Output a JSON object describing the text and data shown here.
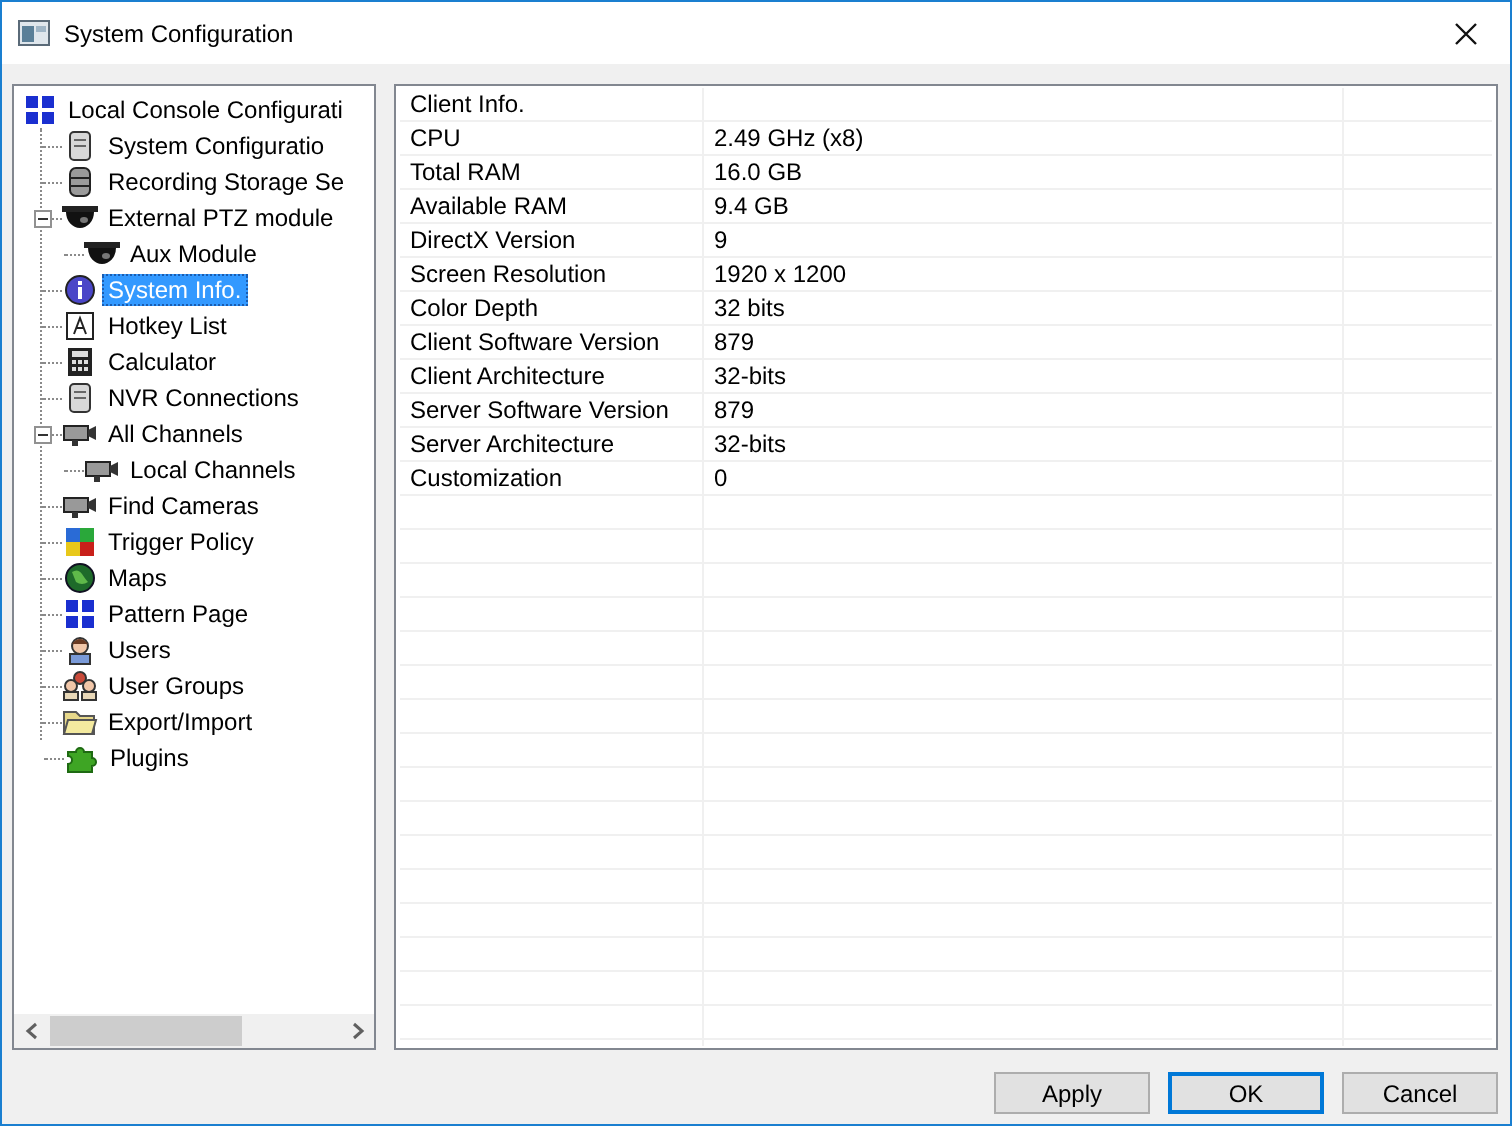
{
  "window": {
    "title": "System Configuration"
  },
  "tree": {
    "items": [
      {
        "label": "Local Console Configurati",
        "selected": false,
        "children": [
          {
            "label": "System Configuratio",
            "selected": false
          },
          {
            "label": "Recording Storage Se",
            "selected": false
          },
          {
            "label": "External PTZ module",
            "selected": false,
            "expanded": true,
            "children": [
              {
                "label": "Aux Module",
                "selected": false
              }
            ]
          },
          {
            "label": "System Info.",
            "selected": true
          },
          {
            "label": "Hotkey List",
            "selected": false
          },
          {
            "label": "Calculator",
            "selected": false
          },
          {
            "label": "NVR Connections",
            "selected": false
          },
          {
            "label": "All Channels",
            "selected": false,
            "expanded": true,
            "children": [
              {
                "label": "Local Channels",
                "selected": false
              }
            ]
          },
          {
            "label": "Find Cameras",
            "selected": false
          },
          {
            "label": "Trigger Policy",
            "selected": false
          },
          {
            "label": "Maps",
            "selected": false
          },
          {
            "label": "Pattern Page",
            "selected": false
          },
          {
            "label": "Users",
            "selected": false
          },
          {
            "label": "User Groups",
            "selected": false
          },
          {
            "label": "Export/Import",
            "selected": false
          },
          {
            "label": "Plugins",
            "selected": false
          }
        ]
      }
    ]
  },
  "table": {
    "rows": [
      {
        "cells": [
          "Client Info."
        ]
      },
      {
        "cells": [
          "CPU",
          "2.49 GHz (x8)"
        ]
      },
      {
        "cells": [
          "Total RAM",
          "16.0 GB"
        ]
      },
      {
        "cells": [
          "Available RAM",
          "9.4 GB"
        ]
      },
      {
        "cells": [
          "DirectX Version",
          "9"
        ]
      },
      {
        "cells": [
          "Screen Resolution",
          "1920 x 1200"
        ]
      },
      {
        "cells": [
          "Color Depth",
          "32 bits"
        ]
      },
      {
        "cells": [
          "Client Software Version",
          "879"
        ]
      },
      {
        "cells": [
          "Client Architecture",
          "32-bits"
        ]
      },
      {
        "cells": [
          "Server Software Version",
          "879"
        ]
      },
      {
        "cells": [
          "Server Architecture",
          "32-bits"
        ]
      },
      {
        "cells": [
          "Customization",
          "0"
        ]
      }
    ]
  },
  "buttons": [
    {
      "label": "Apply",
      "default": false
    },
    {
      "label": "OK",
      "default": true
    },
    {
      "label": "Cancel",
      "default": false
    }
  ]
}
